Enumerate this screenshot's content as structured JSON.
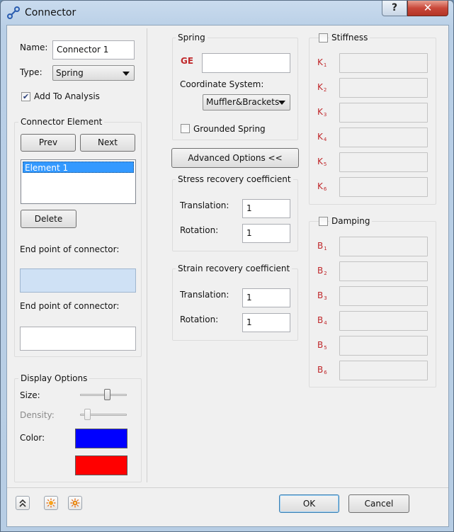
{
  "window": {
    "title": "Connector"
  },
  "titlebar": {
    "help_label": "?",
    "close_label": "✕"
  },
  "left": {
    "name_label": "Name:",
    "name_value": "Connector 1",
    "type_label": "Type:",
    "type_value": "Spring",
    "add_to_analysis_label": "Add To Analysis",
    "add_to_analysis_checked": true,
    "connector_element_title": "Connector Element",
    "prev_label": "Prev",
    "next_label": "Next",
    "elements": [
      "Element 1"
    ],
    "delete_label": "Delete",
    "endpoint1_label": "End point of connector:",
    "endpoint2_label": "End point of connector:",
    "display_options_title": "Display Options",
    "size_label": "Size:",
    "density_label": "Density:",
    "color_label": "Color:",
    "size_level": 0.6,
    "density_level": 0.1,
    "color1": "#0000ff",
    "color2": "#ff0000"
  },
  "spring": {
    "title": "Spring",
    "ge_label": "GE",
    "ge_value": "",
    "coord_label": "Coordinate System:",
    "coord_value": "Muffler&Brackets",
    "grounded_label": "Grounded Spring",
    "grounded_checked": false,
    "advanced_label": "Advanced Options <<",
    "stress_title": "Stress recovery coefficient",
    "strain_title": "Strain recovery coefficient",
    "translation_label": "Translation:",
    "rotation_label": "Rotation:",
    "stress_translation": "1",
    "stress_rotation": "1",
    "strain_translation": "1",
    "strain_rotation": "1"
  },
  "stiffness": {
    "title": "Stiffness",
    "checked": false,
    "labels": [
      "K",
      "K",
      "K",
      "K",
      "K",
      "K"
    ],
    "subs": [
      "1",
      "2",
      "3",
      "4",
      "5",
      "6"
    ]
  },
  "damping": {
    "title": "Damping",
    "checked": false,
    "labels": [
      "B",
      "B",
      "B",
      "B",
      "B",
      "B"
    ],
    "subs": [
      "1",
      "2",
      "3",
      "4",
      "5",
      "6"
    ]
  },
  "footer": {
    "collapse_icon": "double-chevron-up-icon",
    "sun_icon": "sun-icon",
    "sun2_icon": "sun-settings-icon",
    "ok_label": "OK",
    "cancel_label": "Cancel"
  },
  "colors": {
    "accent_red": "#c0282b",
    "selection_blue": "#3399ff"
  }
}
